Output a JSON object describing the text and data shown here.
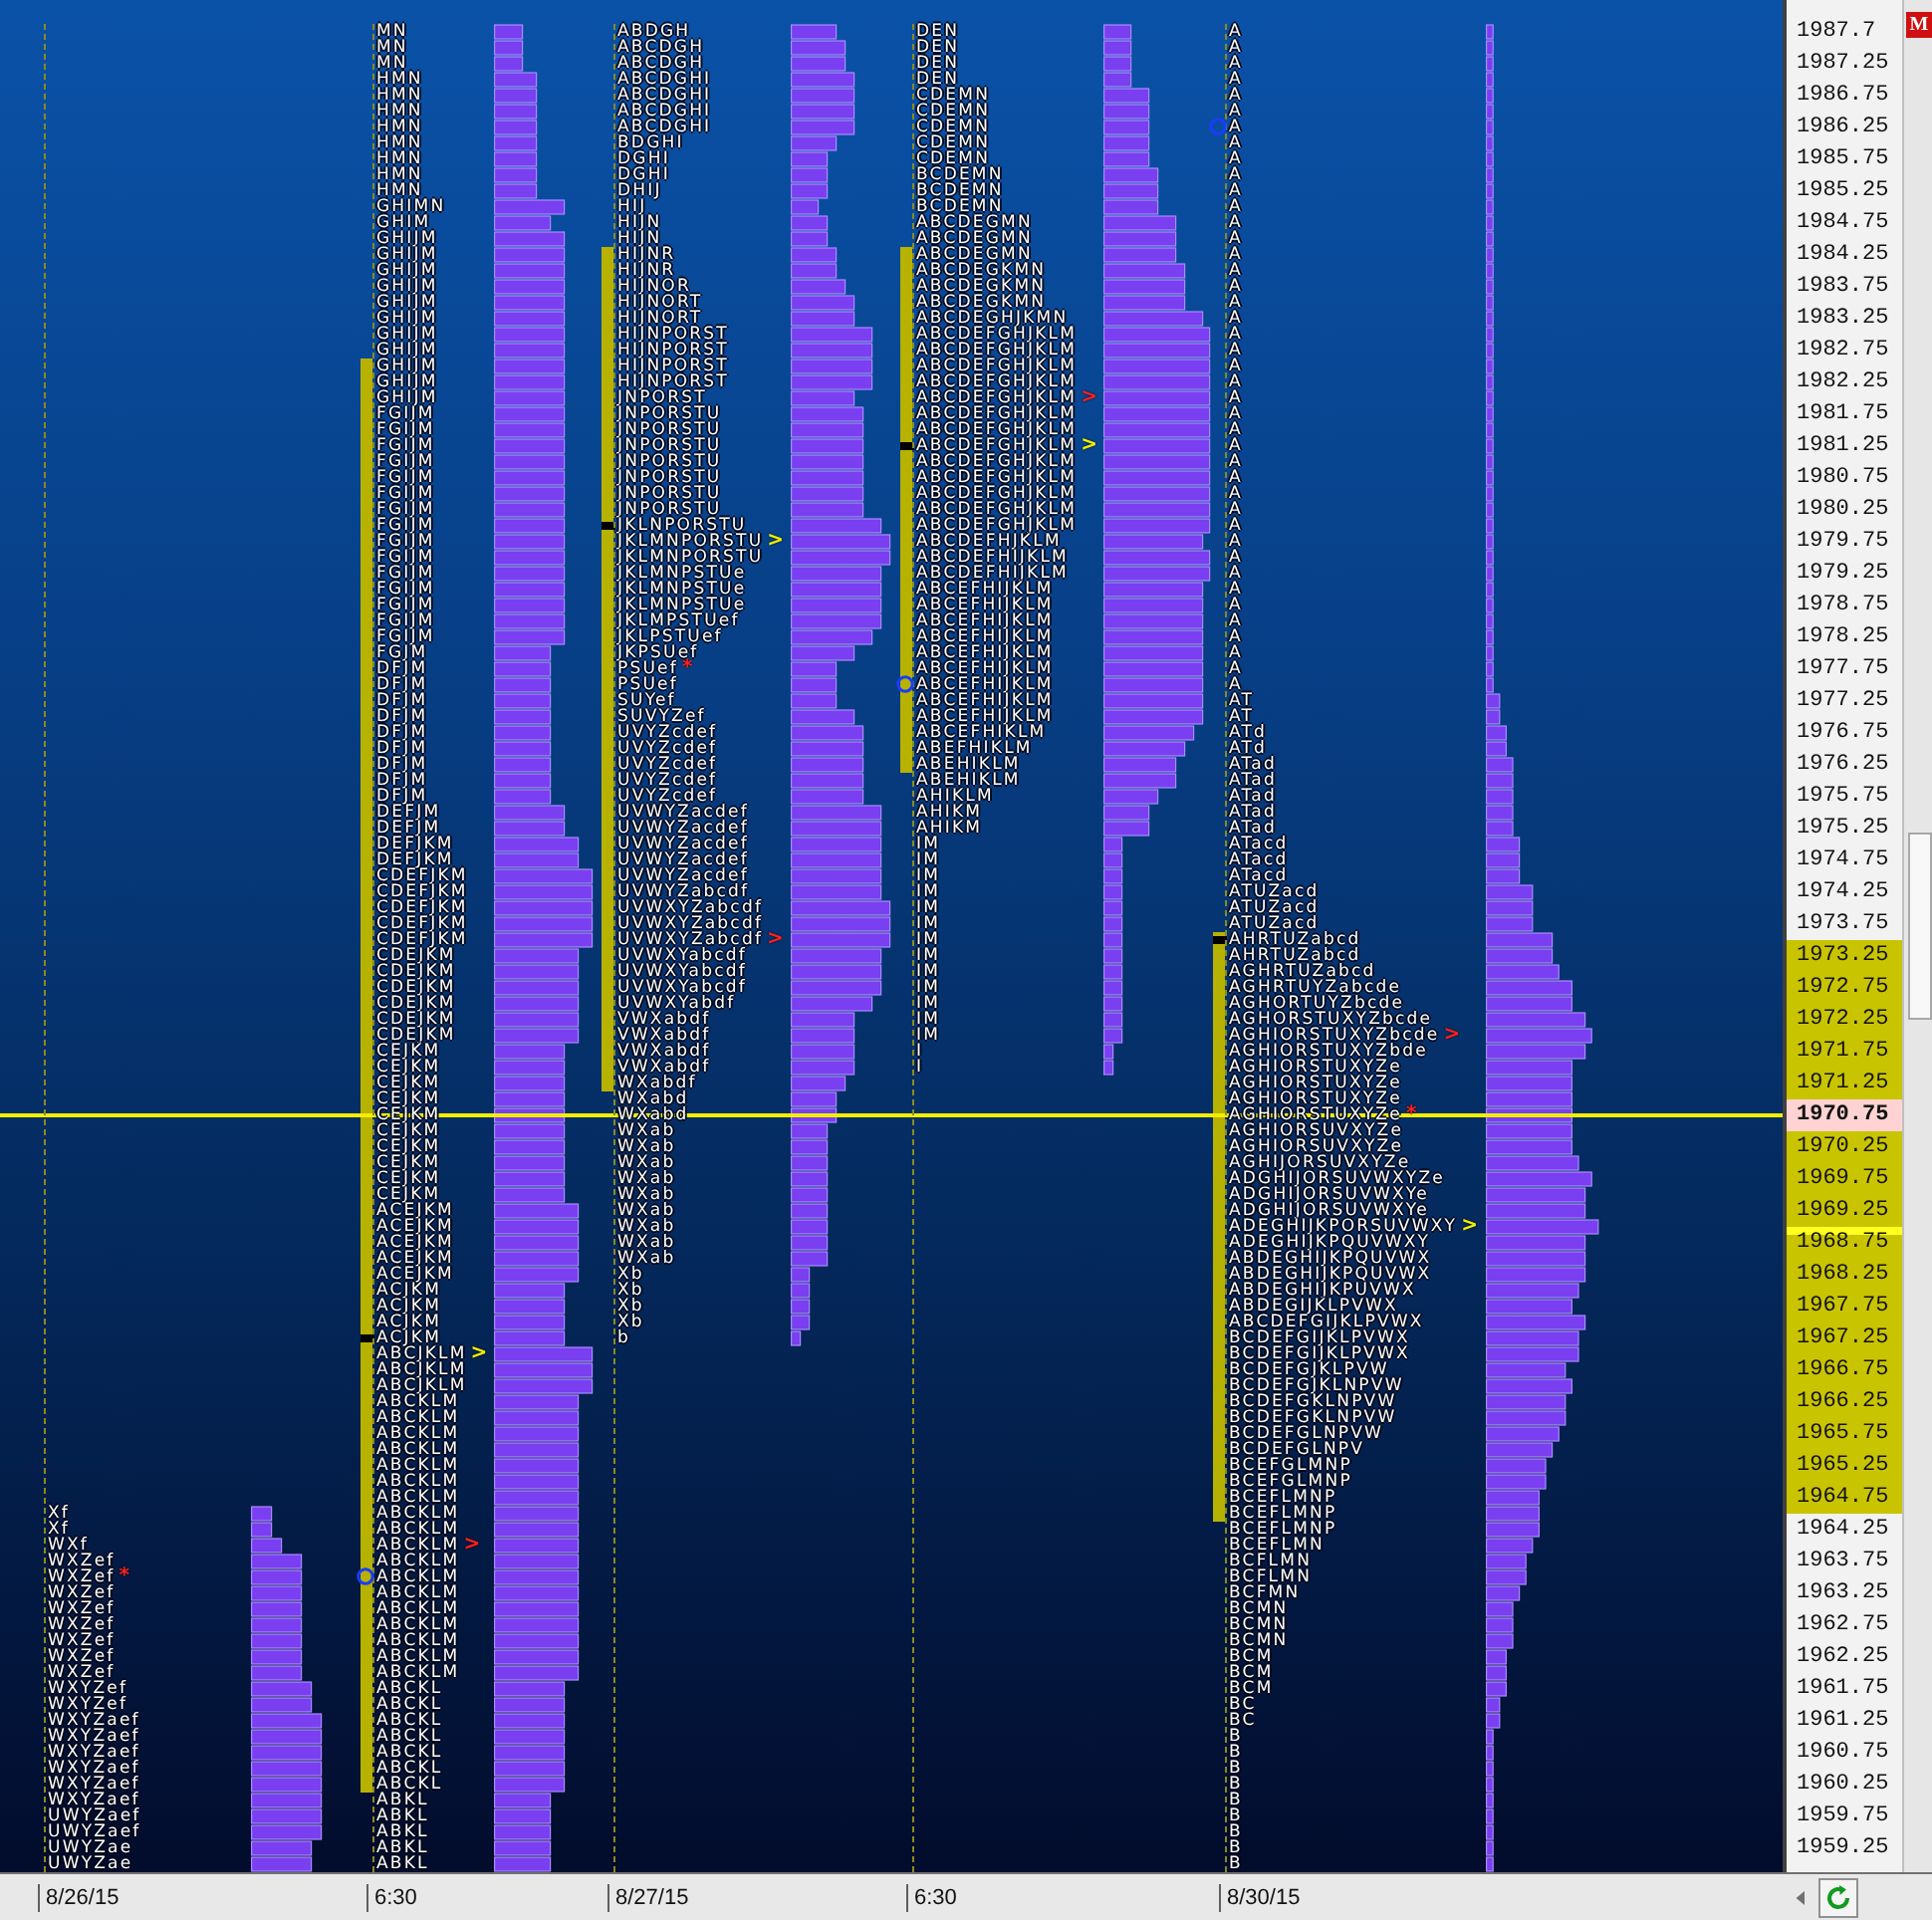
{
  "price_axis": {
    "badge": "M",
    "labels": [
      {
        "text": "1987.7",
        "kind": "plain"
      },
      {
        "text": "1987.25",
        "kind": "plain"
      },
      {
        "text": "1986.75",
        "kind": "plain"
      },
      {
        "text": "1986.25",
        "kind": "plain"
      },
      {
        "text": "1985.75",
        "kind": "plain"
      },
      {
        "text": "1985.25",
        "kind": "plain"
      },
      {
        "text": "1984.75",
        "kind": "plain"
      },
      {
        "text": "1984.25",
        "kind": "plain"
      },
      {
        "text": "1983.75",
        "kind": "plain"
      },
      {
        "text": "1983.25",
        "kind": "plain"
      },
      {
        "text": "1982.75",
        "kind": "plain"
      },
      {
        "text": "1982.25",
        "kind": "plain"
      },
      {
        "text": "1981.75",
        "kind": "plain"
      },
      {
        "text": "1981.25",
        "kind": "plain"
      },
      {
        "text": "1980.75",
        "kind": "plain"
      },
      {
        "text": "1980.25",
        "kind": "plain"
      },
      {
        "text": "1979.75",
        "kind": "plain"
      },
      {
        "text": "1979.25",
        "kind": "plain"
      },
      {
        "text": "1978.75",
        "kind": "plain"
      },
      {
        "text": "1978.25",
        "kind": "plain"
      },
      {
        "text": "1977.75",
        "kind": "plain"
      },
      {
        "text": "1977.25",
        "kind": "plain"
      },
      {
        "text": "1976.75",
        "kind": "plain"
      },
      {
        "text": "1976.25",
        "kind": "plain"
      },
      {
        "text": "1975.75",
        "kind": "plain"
      },
      {
        "text": "1975.25",
        "kind": "plain"
      },
      {
        "text": "1974.75",
        "kind": "plain"
      },
      {
        "text": "1974.25",
        "kind": "plain"
      },
      {
        "text": "1973.75",
        "kind": "plain"
      },
      {
        "text": "1973.25",
        "kind": "band"
      },
      {
        "text": "1972.75",
        "kind": "band"
      },
      {
        "text": "1972.25",
        "kind": "band"
      },
      {
        "text": "1971.75",
        "kind": "band"
      },
      {
        "text": "1971.25",
        "kind": "band"
      },
      {
        "text": "1970.75",
        "kind": "current"
      },
      {
        "text": "1970.25",
        "kind": "band"
      },
      {
        "text": "1969.75",
        "kind": "band"
      },
      {
        "text": "1969.25",
        "kind": "band"
      },
      {
        "text": "1968.75",
        "kind": "band-marked"
      },
      {
        "text": "1968.25",
        "kind": "band"
      },
      {
        "text": "1967.75",
        "kind": "band"
      },
      {
        "text": "1967.25",
        "kind": "band"
      },
      {
        "text": "1966.75",
        "kind": "band"
      },
      {
        "text": "1966.25",
        "kind": "band"
      },
      {
        "text": "1965.75",
        "kind": "band"
      },
      {
        "text": "1965.25",
        "kind": "band"
      },
      {
        "text": "1964.75",
        "kind": "band"
      },
      {
        "text": "1964.25",
        "kind": "plain"
      },
      {
        "text": "1963.75",
        "kind": "plain"
      },
      {
        "text": "1963.25",
        "kind": "plain"
      },
      {
        "text": "1962.75",
        "kind": "plain"
      },
      {
        "text": "1962.25",
        "kind": "plain"
      },
      {
        "text": "1961.75",
        "kind": "plain"
      },
      {
        "text": "1961.25",
        "kind": "plain"
      },
      {
        "text": "1960.75",
        "kind": "plain"
      },
      {
        "text": "1960.25",
        "kind": "plain"
      },
      {
        "text": "1959.75",
        "kind": "plain"
      },
      {
        "text": "1959.25",
        "kind": "plain"
      }
    ]
  },
  "profiles": [
    {
      "date_label": "8/26/15",
      "kind": "bottom-anchored",
      "rows": [
        {
          "tpo": "Xf"
        },
        {
          "tpo": "Xf"
        },
        {
          "tpo": "WXf"
        },
        {
          "tpo": "WXZef"
        },
        {
          "tpo": "WXZef",
          "marker": "*",
          "color": "#ff2020"
        },
        {
          "tpo": "WXZef"
        },
        {
          "tpo": "WXZef"
        },
        {
          "tpo": "WXZef"
        },
        {
          "tpo": "WXZef"
        },
        {
          "tpo": "WXZef"
        },
        {
          "tpo": "WXZef"
        },
        {
          "tpo": "WXYZef"
        },
        {
          "tpo": "WXYZef"
        },
        {
          "tpo": "WXYZaef"
        },
        {
          "tpo": "WXYZaef"
        },
        {
          "tpo": "WXYZaef"
        },
        {
          "tpo": "WXYZaef"
        },
        {
          "tpo": "WXYZaef"
        },
        {
          "tpo": "WXYZaef"
        },
        {
          "tpo": "UWYZaef"
        },
        {
          "tpo": "UWYZaef"
        },
        {
          "tpo": "UWYZae"
        },
        {
          "tpo": "UWYZae"
        }
      ]
    },
    {
      "date_label": "6:30",
      "kind": "bottom-anchored",
      "rows": [
        {
          "tpo": "MN"
        },
        {
          "tpo": "MN"
        },
        {
          "tpo": "MN"
        },
        {
          "tpo": "HMN"
        },
        {
          "tpo": "HMN"
        },
        {
          "tpo": "HMN"
        },
        {
          "tpo": "HMN"
        },
        {
          "tpo": "HMN"
        },
        {
          "tpo": "HMN"
        },
        {
          "tpo": "HMN"
        },
        {
          "tpo": "HMN"
        },
        {
          "tpo": "GHIMN"
        },
        {
          "tpo": "GHIM"
        },
        {
          "tpo": "GHIJM"
        },
        {
          "tpo": "GHIJM"
        },
        {
          "tpo": "GHIJM"
        },
        {
          "tpo": "GHIJM"
        },
        {
          "tpo": "GHIJM"
        },
        {
          "tpo": "GHIJM"
        },
        {
          "tpo": "GHIJM"
        },
        {
          "tpo": "GHIJM"
        },
        {
          "tpo": "GHIJM",
          "kind": "va-high"
        },
        {
          "tpo": "GHIJM"
        },
        {
          "tpo": "GHIJM"
        },
        {
          "tpo": "FGIJM"
        },
        {
          "tpo": "FGIJM"
        },
        {
          "tpo": "FGIJM"
        },
        {
          "tpo": "FGIJM"
        },
        {
          "tpo": "FGIJM"
        },
        {
          "tpo": "FGIJM"
        },
        {
          "tpo": "FGIJM"
        },
        {
          "tpo": "FGIJM"
        },
        {
          "tpo": "FGIJM"
        },
        {
          "tpo": "FGIJM"
        },
        {
          "tpo": "FGIJM"
        },
        {
          "tpo": "FGIJM"
        },
        {
          "tpo": "FGIJM"
        },
        {
          "tpo": "FGIJM"
        },
        {
          "tpo": "FGIJM"
        },
        {
          "tpo": "FGJM"
        },
        {
          "tpo": "DFJM"
        },
        {
          "tpo": "DFJM"
        },
        {
          "tpo": "DFJM"
        },
        {
          "tpo": "DFJM"
        },
        {
          "tpo": "DFJM"
        },
        {
          "tpo": "DFJM"
        },
        {
          "tpo": "DFJM"
        },
        {
          "tpo": "DFJM"
        },
        {
          "tpo": "DFJM"
        },
        {
          "tpo": "DEFJM"
        },
        {
          "tpo": "DEFJM"
        },
        {
          "tpo": "DEFJKM"
        },
        {
          "tpo": "DEFJKM"
        },
        {
          "tpo": "CDEFJKM"
        },
        {
          "tpo": "CDEFJKM"
        },
        {
          "tpo": "CDEFJKM"
        },
        {
          "tpo": "CDEFJKM"
        },
        {
          "tpo": "CDEFJKM"
        },
        {
          "tpo": "CDEJKM"
        },
        {
          "tpo": "CDEJKM"
        },
        {
          "tpo": "CDEJKM"
        },
        {
          "tpo": "CDEJKM"
        },
        {
          "tpo": "CDEJKM"
        },
        {
          "tpo": "CDEJKM"
        },
        {
          "tpo": "CEJKM"
        },
        {
          "tpo": "CEJKM"
        },
        {
          "tpo": "CEJKM"
        },
        {
          "tpo": "CEJKM"
        },
        {
          "tpo": "CEJKM"
        },
        {
          "tpo": "CEJKM"
        },
        {
          "tpo": "CEJKM"
        },
        {
          "tpo": "CEJKM"
        },
        {
          "tpo": "CEJKM"
        },
        {
          "tpo": "CEJKM"
        },
        {
          "tpo": "ACEJKM"
        },
        {
          "tpo": "ACEJKM"
        },
        {
          "tpo": "ACEJKM"
        },
        {
          "tpo": "ACEJKM"
        },
        {
          "tpo": "ACEJKM"
        },
        {
          "tpo": "ACJKM"
        },
        {
          "tpo": "ACJKM"
        },
        {
          "tpo": "ACJKM"
        },
        {
          "tpo": "ACJKM",
          "kind": "poc"
        },
        {
          "tpo": "ABCJKLM",
          "marker": ">",
          "color": "#f0f000"
        },
        {
          "tpo": "ABCJKLM"
        },
        {
          "tpo": "ABCJKLM"
        },
        {
          "tpo": "ABCKLM"
        },
        {
          "tpo": "ABCKLM"
        },
        {
          "tpo": "ABCKLM"
        },
        {
          "tpo": "ABCKLM"
        },
        {
          "tpo": "ABCKLM"
        },
        {
          "tpo": "ABCKLM"
        },
        {
          "tpo": "ABCKLM"
        },
        {
          "tpo": "ABCKLM"
        },
        {
          "tpo": "ABCKLM"
        },
        {
          "tpo": "ABCKLM",
          "marker": ">",
          "color": "#ff2020"
        },
        {
          "tpo": "ABCKLM"
        },
        {
          "tpo": "ABCKLM",
          "kind": "circle"
        },
        {
          "tpo": "ABCKLM"
        },
        {
          "tpo": "ABCKLM"
        },
        {
          "tpo": "ABCKLM"
        },
        {
          "tpo": "ABCKLM"
        },
        {
          "tpo": "ABCKLM"
        },
        {
          "tpo": "ABCKLM"
        },
        {
          "tpo": "ABCKL"
        },
        {
          "tpo": "ABCKL"
        },
        {
          "tpo": "ABCKL"
        },
        {
          "tpo": "ABCKL"
        },
        {
          "tpo": "ABCKL"
        },
        {
          "tpo": "ABCKL"
        },
        {
          "tpo": "ABCKL",
          "kind": "va-low"
        },
        {
          "tpo": "ABKL"
        },
        {
          "tpo": "ABKL"
        },
        {
          "tpo": "ABKL"
        },
        {
          "tpo": "ABKL"
        },
        {
          "tpo": "ABKL"
        }
      ]
    },
    {
      "date_label": "8/27/15",
      "kind": "top-anchored",
      "rows": [
        {
          "tpo": "ABDGH"
        },
        {
          "tpo": "ABCDGH"
        },
        {
          "tpo": "ABCDGH"
        },
        {
          "tpo": "ABCDGHI"
        },
        {
          "tpo": "ABCDGHI"
        },
        {
          "tpo": "ABCDGHI"
        },
        {
          "tpo": "ABCDGHI"
        },
        {
          "tpo": "BDGHI"
        },
        {
          "tpo": "DGHI"
        },
        {
          "tpo": "DGHI"
        },
        {
          "tpo": "DHIJ"
        },
        {
          "tpo": "HIJ"
        },
        {
          "tpo": "HIJN"
        },
        {
          "tpo": "HIJN"
        },
        {
          "tpo": "HIJNR",
          "kind": "va-high"
        },
        {
          "tpo": "HIJNR"
        },
        {
          "tpo": "HIJNOR"
        },
        {
          "tpo": "HIJNORT"
        },
        {
          "tpo": "HIJNORT"
        },
        {
          "tpo": "HIJNPORST"
        },
        {
          "tpo": "HIJNPORST"
        },
        {
          "tpo": "HIJNPORST"
        },
        {
          "tpo": "HIJNPORST"
        },
        {
          "tpo": "JNPORST"
        },
        {
          "tpo": "JNPORSTU"
        },
        {
          "tpo": "JNPORSTU"
        },
        {
          "tpo": "JNPORSTU"
        },
        {
          "tpo": "JNPORSTU"
        },
        {
          "tpo": "JNPORSTU"
        },
        {
          "tpo": "JNPORSTU"
        },
        {
          "tpo": "JNPORSTU"
        },
        {
          "tpo": "JKLNPORSTU",
          "kind": "poc"
        },
        {
          "tpo": "JKLMNPORSTU",
          "marker": ">",
          "color": "#f0f000"
        },
        {
          "tpo": "JKLMNPORSTU"
        },
        {
          "tpo": "JKLMNPSTUe"
        },
        {
          "tpo": "JKLMNPSTUe"
        },
        {
          "tpo": "JKLMNPSTUe"
        },
        {
          "tpo": "JKLMPSTUef"
        },
        {
          "tpo": "JKLPSTUef"
        },
        {
          "tpo": "JKPSUef"
        },
        {
          "tpo": "PSUef",
          "marker": "*",
          "color": "#ff2020"
        },
        {
          "tpo": "PSUef"
        },
        {
          "tpo": "SUYef"
        },
        {
          "tpo": "SUVYZef"
        },
        {
          "tpo": "UVYZcdef"
        },
        {
          "tpo": "UVYZcdef"
        },
        {
          "tpo": "UVYZcdef"
        },
        {
          "tpo": "UVYZcdef"
        },
        {
          "tpo": "UVYZcdef"
        },
        {
          "tpo": "UVWYZacdef"
        },
        {
          "tpo": "UVWYZacdef"
        },
        {
          "tpo": "UVWYZacdef"
        },
        {
          "tpo": "UVWYZacdef"
        },
        {
          "tpo": "UVWYZacdef"
        },
        {
          "tpo": "UVWYZabcdf"
        },
        {
          "tpo": "UVWXYZabcdf"
        },
        {
          "tpo": "UVWXYZabcdf"
        },
        {
          "tpo": "UVWXYZabcdf",
          "marker": ">",
          "color": "#ff2020"
        },
        {
          "tpo": "UVWXYabcdf"
        },
        {
          "tpo": "UVWXYabcdf"
        },
        {
          "tpo": "UVWXYabcdf"
        },
        {
          "tpo": "UVWXYabdf"
        },
        {
          "tpo": "VWXabdf"
        },
        {
          "tpo": "VWXabdf"
        },
        {
          "tpo": "VWXabdf"
        },
        {
          "tpo": "VWXabdf"
        },
        {
          "tpo": "WXabdf",
          "kind": "va-low"
        },
        {
          "tpo": "WXabd"
        },
        {
          "tpo": "WXabd"
        },
        {
          "tpo": "WXab"
        },
        {
          "tpo": "WXab"
        },
        {
          "tpo": "WXab"
        },
        {
          "tpo": "WXab"
        },
        {
          "tpo": "WXab"
        },
        {
          "tpo": "WXab"
        },
        {
          "tpo": "WXab"
        },
        {
          "tpo": "WXab"
        },
        {
          "tpo": "WXab"
        },
        {
          "tpo": "Xb"
        },
        {
          "tpo": "Xb"
        },
        {
          "tpo": "Xb"
        },
        {
          "tpo": "Xb"
        },
        {
          "tpo": "b"
        }
      ]
    },
    {
      "date_label": "6:30",
      "kind": "top-anchored",
      "rows": [
        {
          "tpo": "DEN"
        },
        {
          "tpo": "DEN"
        },
        {
          "tpo": "DEN"
        },
        {
          "tpo": "DEN"
        },
        {
          "tpo": "CDEMN"
        },
        {
          "tpo": "CDEMN"
        },
        {
          "tpo": "CDEMN"
        },
        {
          "tpo": "CDEMN"
        },
        {
          "tpo": "CDEMN"
        },
        {
          "tpo": "BCDEMN"
        },
        {
          "tpo": "BCDEMN"
        },
        {
          "tpo": "BCDEMN"
        },
        {
          "tpo": "ABCDEGMN"
        },
        {
          "tpo": "ABCDEGMN"
        },
        {
          "tpo": "ABCDEGMN",
          "kind": "va-high"
        },
        {
          "tpo": "ABCDEGKMN"
        },
        {
          "tpo": "ABCDEGKMN"
        },
        {
          "tpo": "ABCDEGKMN"
        },
        {
          "tpo": "ABCDEGHJKMN"
        },
        {
          "tpo": "ABCDEFGHJKLM"
        },
        {
          "tpo": "ABCDEFGHJKLM"
        },
        {
          "tpo": "ABCDEFGHJKLM"
        },
        {
          "tpo": "ABCDEFGHJKLM"
        },
        {
          "tpo": "ABCDEFGHJKLM",
          "marker": ">",
          "color": "#ff2020"
        },
        {
          "tpo": "ABCDEFGHJKLM"
        },
        {
          "tpo": "ABCDEFGHJKLM"
        },
        {
          "tpo": "ABCDEFGHJKLM",
          "marker": ">",
          "color": "#f0f000",
          "kind": "poc"
        },
        {
          "tpo": "ABCDEFGHJKLM"
        },
        {
          "tpo": "ABCDEFGHJKLM"
        },
        {
          "tpo": "ABCDEFGHJKLM"
        },
        {
          "tpo": "ABCDEFGHJKLM"
        },
        {
          "tpo": "ABCDEFGHJKLM"
        },
        {
          "tpo": "ABCDEFHJKLM"
        },
        {
          "tpo": "ABCDEFHIJKLM"
        },
        {
          "tpo": "ABCDEFHIJKLM"
        },
        {
          "tpo": "ABCEFHIJKLM"
        },
        {
          "tpo": "ABCEFHIJKLM"
        },
        {
          "tpo": "ABCEFHIJKLM"
        },
        {
          "tpo": "ABCEFHIJKLM"
        },
        {
          "tpo": "ABCEFHIJKLM"
        },
        {
          "tpo": "ABCEFHIJKLM"
        },
        {
          "tpo": "ABCEFHIJKLM",
          "kind": "circle"
        },
        {
          "tpo": "ABCEFHIJKLM"
        },
        {
          "tpo": "ABCEFHIJKLM"
        },
        {
          "tpo": "ABCEFHIKLM"
        },
        {
          "tpo": "ABEFHIKLM"
        },
        {
          "tpo": "ABEHIKLM",
          "kind": "va-low"
        },
        {
          "tpo": "ABEHIKLM"
        },
        {
          "tpo": "AHIKLM"
        },
        {
          "tpo": "AHIKM"
        },
        {
          "tpo": "AHIKM"
        },
        {
          "tpo": "IM"
        },
        {
          "tpo": "IM"
        },
        {
          "tpo": "IM"
        },
        {
          "tpo": "IM"
        },
        {
          "tpo": "IM"
        },
        {
          "tpo": "IM"
        },
        {
          "tpo": "IM"
        },
        {
          "tpo": "IM"
        },
        {
          "tpo": "IM"
        },
        {
          "tpo": "IM"
        },
        {
          "tpo": "IM"
        },
        {
          "tpo": "IM"
        },
        {
          "tpo": "IM"
        },
        {
          "tpo": "I"
        },
        {
          "tpo": "I"
        }
      ]
    },
    {
      "date_label": "8/30/15",
      "kind": "bottom-anchored",
      "rows": [
        {
          "tpo": "A"
        },
        {
          "tpo": "A"
        },
        {
          "tpo": "A"
        },
        {
          "tpo": "A"
        },
        {
          "tpo": "A"
        },
        {
          "tpo": "A"
        },
        {
          "tpo": "A",
          "kind": "circle"
        },
        {
          "tpo": "A"
        },
        {
          "tpo": "A"
        },
        {
          "tpo": "A"
        },
        {
          "tpo": "A"
        },
        {
          "tpo": "A"
        },
        {
          "tpo": "A"
        },
        {
          "tpo": "A"
        },
        {
          "tpo": "A"
        },
        {
          "tpo": "A"
        },
        {
          "tpo": "A"
        },
        {
          "tpo": "A"
        },
        {
          "tpo": "A"
        },
        {
          "tpo": "A"
        },
        {
          "tpo": "A"
        },
        {
          "tpo": "A"
        },
        {
          "tpo": "A"
        },
        {
          "tpo": "A"
        },
        {
          "tpo": "A"
        },
        {
          "tpo": "A"
        },
        {
          "tpo": "A"
        },
        {
          "tpo": "A"
        },
        {
          "tpo": "A"
        },
        {
          "tpo": "A"
        },
        {
          "tpo": "A"
        },
        {
          "tpo": "A"
        },
        {
          "tpo": "A"
        },
        {
          "tpo": "A"
        },
        {
          "tpo": "A"
        },
        {
          "tpo": "A"
        },
        {
          "tpo": "A"
        },
        {
          "tpo": "A"
        },
        {
          "tpo": "A"
        },
        {
          "tpo": "A"
        },
        {
          "tpo": "A"
        },
        {
          "tpo": "A"
        },
        {
          "tpo": "AT"
        },
        {
          "tpo": "AT"
        },
        {
          "tpo": "ATd"
        },
        {
          "tpo": "ATd"
        },
        {
          "tpo": "ATad"
        },
        {
          "tpo": "ATad"
        },
        {
          "tpo": "ATad"
        },
        {
          "tpo": "ATad"
        },
        {
          "tpo": "ATad"
        },
        {
          "tpo": "ATacd"
        },
        {
          "tpo": "ATacd"
        },
        {
          "tpo": "ATacd"
        },
        {
          "tpo": "ATUZacd"
        },
        {
          "tpo": "ATUZacd"
        },
        {
          "tpo": "ATUZacd"
        },
        {
          "tpo": "AHRTUZabcd",
          "kind": "va-high-poc"
        },
        {
          "tpo": "AHRTUZabcd"
        },
        {
          "tpo": "AGHRTUZabcd"
        },
        {
          "tpo": "AGHRTUYZabcde"
        },
        {
          "tpo": "AGHORTUYZbcde"
        },
        {
          "tpo": "AGHORSTUXYZbcde"
        },
        {
          "tpo": "AGHIORSTUXYZbcde",
          "marker": ">",
          "color": "#ff2020"
        },
        {
          "tpo": "AGHIORSTUXYZbde"
        },
        {
          "tpo": "AGHIORSTUXYZe"
        },
        {
          "tpo": "AGHIORSTUXYZe"
        },
        {
          "tpo": "AGHIORSTUXYZe"
        },
        {
          "tpo": "AGHIORSTUXYZe",
          "marker": "*",
          "color": "#ff2020"
        },
        {
          "tpo": "AGHIORSUVXYZe"
        },
        {
          "tpo": "AGHIORSUVXYZe"
        },
        {
          "tpo": "AGHIJORSUVXYZe"
        },
        {
          "tpo": "ADGHIJORSUVWXYZe"
        },
        {
          "tpo": "ADGHIJORSUVWXYe"
        },
        {
          "tpo": "ADGHIJORSUVWXYe"
        },
        {
          "tpo": "ADEGHIJKPORSUVWXY",
          "marker": ">",
          "color": "#f0f000"
        },
        {
          "tpo": "ADEGHIJKPQUVWXY"
        },
        {
          "tpo": "ABDEGHIJKPQUVWX"
        },
        {
          "tpo": "ABDEGHIJKPQUVWX"
        },
        {
          "tpo": "ABDEGHIJKPUVWX"
        },
        {
          "tpo": "ABDEGIJKLPVWX"
        },
        {
          "tpo": "ABCDEFGIJKLPVWX"
        },
        {
          "tpo": "BCDEFGIJKLPVWX"
        },
        {
          "tpo": "BCDEFGIJKLPVWX"
        },
        {
          "tpo": "BCDEFGJKLPVW"
        },
        {
          "tpo": "BCDEFGJKLNPVW"
        },
        {
          "tpo": "BCDEFGKLNPVW"
        },
        {
          "tpo": "BCDEFGKLNPVW"
        },
        {
          "tpo": "BCDEFGLNPVW"
        },
        {
          "tpo": "BCDEFGLNPV"
        },
        {
          "tpo": "BCEFGLMNP"
        },
        {
          "tpo": "BCEFGLMNP"
        },
        {
          "tpo": "BCEFLMNP"
        },
        {
          "tpo": "BCEFLMNP",
          "kind": "va-low"
        },
        {
          "tpo": "BCEFLMNP"
        },
        {
          "tpo": "BCEFLMN"
        },
        {
          "tpo": "BCFLMN"
        },
        {
          "tpo": "BCFLMN"
        },
        {
          "tpo": "BCFMN"
        },
        {
          "tpo": "BCMN"
        },
        {
          "tpo": "BCMN"
        },
        {
          "tpo": "BCMN"
        },
        {
          "tpo": "BCM"
        },
        {
          "tpo": "BCM"
        },
        {
          "tpo": "BCM"
        },
        {
          "tpo": "BC"
        },
        {
          "tpo": "BC"
        },
        {
          "tpo": "B"
        },
        {
          "tpo": "B"
        },
        {
          "tpo": "B"
        },
        {
          "tpo": "B"
        },
        {
          "tpo": "B"
        },
        {
          "tpo": "B"
        },
        {
          "tpo": "B"
        },
        {
          "tpo": "B"
        },
        {
          "tpo": "B"
        }
      ]
    }
  ]
}
